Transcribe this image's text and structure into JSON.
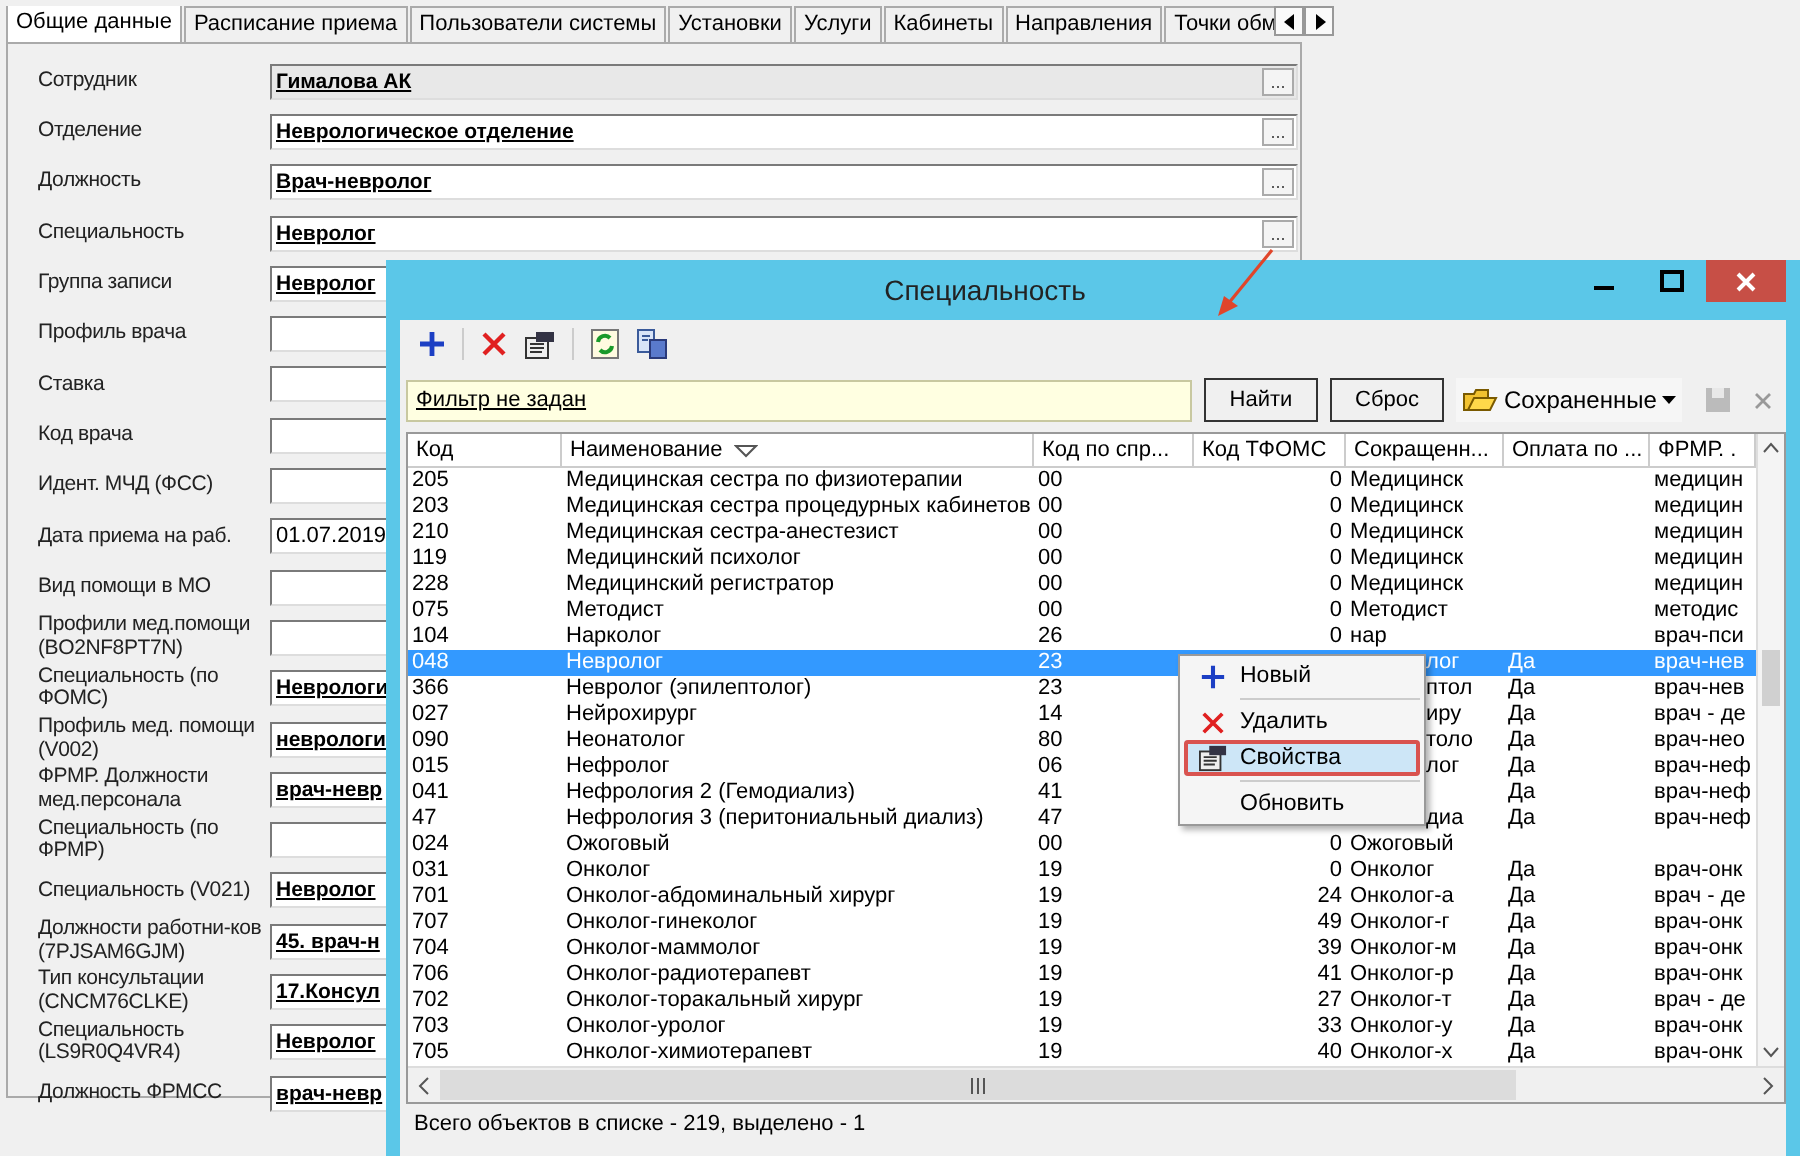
{
  "tabs": [
    {
      "label": "Общие данные",
      "selected": true
    },
    {
      "label": "Расписание приема",
      "selected": false
    },
    {
      "label": "Пользователи системы",
      "selected": false
    },
    {
      "label": "Установки",
      "selected": false
    },
    {
      "label": "Услуги",
      "selected": false
    },
    {
      "label": "Кабинеты",
      "selected": false
    },
    {
      "label": "Направления",
      "selected": false
    },
    {
      "label": "Точки обм",
      "selected": false
    }
  ],
  "fields": [
    {
      "label": "Сотрудник",
      "value": "Гималова АК",
      "kind": "picker",
      "button": "...",
      "disabled": true
    },
    {
      "label": "Отделение",
      "value": "Неврологическое отделение",
      "kind": "picker",
      "button": "...",
      "disabled": false
    },
    {
      "label": "Должность",
      "value": "Врач-невролог",
      "kind": "picker",
      "button": "...",
      "disabled": false
    },
    {
      "label": "Специальность",
      "value": "Невролог",
      "kind": "picker",
      "button": "...",
      "disabled": false
    },
    {
      "label": "Группа записи",
      "value": "Невролог",
      "kind": "ref",
      "disabled": false
    },
    {
      "label": "Профиль врача",
      "kind": "input",
      "disabled": false
    },
    {
      "label": "Ставка",
      "kind": "input",
      "disabled": false
    },
    {
      "label": "Код врача",
      "kind": "input",
      "disabled": false
    },
    {
      "label": "Идент. МЧД (ФСС)",
      "kind": "input",
      "disabled": false
    },
    {
      "label": "Дата приема на раб.",
      "value": "01.07.2019",
      "kind": "input",
      "disabled": false
    },
    {
      "label": "Вид помощи в МО",
      "kind": "input",
      "disabled": false
    },
    {
      "label": "Профили мед.помощи (BO2NF8PT7N)",
      "kind": "input",
      "disabled": false
    },
    {
      "label": "Специальность (по ФОМС)",
      "value": "Неврологи",
      "kind": "ref",
      "disabled": false
    },
    {
      "label": "Профиль мед. помощи (V002)",
      "value": "неврологи",
      "kind": "ref",
      "disabled": false
    },
    {
      "label": "ФРМР. Должности мед.персонала",
      "value": "врач-невр",
      "kind": "ref",
      "disabled": false
    },
    {
      "label": "Специальность (по ФРМР)",
      "kind": "input",
      "disabled": false
    },
    {
      "label": "Специальность (V021)",
      "value": "Невролог",
      "kind": "ref",
      "disabled": false
    },
    {
      "label": "Должности работни-ков (7PJSAM6GJM)",
      "value": "45. врач-н",
      "kind": "ref",
      "disabled": false
    },
    {
      "label": "Тип консультации (CNCM76CLKE)",
      "value": "17.Консул",
      "kind": "ref",
      "disabled": false
    },
    {
      "label": "Специальность (LS9R0Q4VR4)",
      "value": "Невролог",
      "kind": "ref",
      "disabled": false
    },
    {
      "label": "Должность ФРМСС",
      "value": "врач-невр",
      "kind": "ref",
      "disabled": false
    }
  ],
  "dialog": {
    "title": "Специальность",
    "filter": {
      "text": "Фильтр не задан",
      "find_button": "Найти",
      "reset_button": "Сброс",
      "saved_button": "Сохраненные"
    },
    "columns": [
      "Код",
      "Наименование",
      "Код по спр...",
      "Код ТФОМС",
      "Сокращенн...",
      "Оплата по ...",
      "ФРМР. ."
    ],
    "rows": [
      {
        "code": "205",
        "name": "Медицинская сестра по физиотерапии",
        "code_sp": "00",
        "tfoms": "0",
        "short": "Медицинск",
        "frmp": "медицин",
        "selected": false
      },
      {
        "code": "203",
        "name": "Медицинская сестра процедурных кабинетов",
        "code_sp": "00",
        "tfoms": "0",
        "short": "Медицинск",
        "frmp": "медицин",
        "selected": false
      },
      {
        "code": "210",
        "name": "Медицинская сестра-анестезист",
        "code_sp": "00",
        "tfoms": "0",
        "short": "Медицинск",
        "frmp": "медицин",
        "selected": false
      },
      {
        "code": "119",
        "name": "Медицинский психолог",
        "code_sp": "00",
        "tfoms": "0",
        "short": "Медицинск",
        "frmp": "медицин",
        "selected": false
      },
      {
        "code": "228",
        "name": "Медицинский регистратор",
        "code_sp": "00",
        "tfoms": "0",
        "short": "Медицинск",
        "frmp": "медицин",
        "selected": false
      },
      {
        "code": "075",
        "name": "Методист",
        "code_sp": "00",
        "tfoms": "0",
        "short": "Методист",
        "frmp": "методис",
        "selected": false
      },
      {
        "code": "104",
        "name": "Нарколог",
        "code_sp": "26",
        "tfoms": "0",
        "short": "нар",
        "frmp": "врач-пси",
        "selected": false
      },
      {
        "code": "048",
        "name": "Невролог",
        "code_sp": "23",
        "short_tail": "лог",
        "payment": "Да",
        "frmp": "врач-нев",
        "selected": true
      },
      {
        "code": "366",
        "name": "Невролог (эпилептолог)",
        "code_sp": "23",
        "short_tail": "птол",
        "payment": "Да",
        "frmp": "врач-нев",
        "selected": false
      },
      {
        "code": "027",
        "name": "Нейрохирург",
        "code_sp": "14",
        "short_tail": "иру",
        "payment": "Да",
        "frmp": "врач - де",
        "selected": false
      },
      {
        "code": "090",
        "name": "Неонатолог",
        "code_sp": "80",
        "short_tail": "толо",
        "payment": "Да",
        "frmp": "врач-нео",
        "selected": false
      },
      {
        "code": "015",
        "name": "Нефролог",
        "code_sp": "06",
        "short_tail": "лог",
        "payment": "Да",
        "frmp": "врач-неф",
        "selected": false
      },
      {
        "code": "041",
        "name": "Нефрология 2 (Гемодиализ)",
        "code_sp": "41",
        "payment": "Да",
        "frmp": "врач-неф",
        "selected": false
      },
      {
        "code": "47",
        "name": "Нефрология 3 (перитониальный диализ)",
        "code_sp": "47",
        "short_tail": "диа",
        "payment": "Да",
        "frmp": "врач-неф",
        "selected": false
      },
      {
        "code": "024",
        "name": "Ожоговый",
        "code_sp": "00",
        "tfoms": "0",
        "short": "Ожоговый",
        "selected": false
      },
      {
        "code": "031",
        "name": "Онколог",
        "code_sp": "19",
        "tfoms": "0",
        "short": "Онколог",
        "payment": "Да",
        "frmp": "врач-онк",
        "selected": false
      },
      {
        "code": "701",
        "name": "Онколог-абдоминальный хирург",
        "code_sp": "19",
        "tfoms": "24",
        "short": "Онколог-а",
        "payment": "Да",
        "frmp": "врач - де",
        "selected": false
      },
      {
        "code": "707",
        "name": "Онколог-гинеколог",
        "code_sp": "19",
        "tfoms": "49",
        "short": "Онколог-г",
        "payment": "Да",
        "frmp": "врач-онк",
        "selected": false
      },
      {
        "code": "704",
        "name": "Онколог-маммолог",
        "code_sp": "19",
        "tfoms": "39",
        "short": "Онколог-м",
        "payment": "Да",
        "frmp": "врач-онк",
        "selected": false
      },
      {
        "code": "706",
        "name": "Онколог-радиотерапевт",
        "code_sp": "19",
        "tfoms": "41",
        "short": "Онколог-р",
        "payment": "Да",
        "frmp": "врач-онк",
        "selected": false
      },
      {
        "code": "702",
        "name": "Онколог-торакальный хирург",
        "code_sp": "19",
        "tfoms": "27",
        "short": "Онколог-т",
        "payment": "Да",
        "frmp": "врач - де",
        "selected": false
      },
      {
        "code": "703",
        "name": "Онколог-уролог",
        "code_sp": "19",
        "tfoms": "33",
        "short": "Онколог-у",
        "payment": "Да",
        "frmp": "врач-онк",
        "selected": false
      },
      {
        "code": "705",
        "name": "Онколог-химиотерапевт",
        "code_sp": "19",
        "tfoms": "40",
        "short": "Онколог-х",
        "payment": "Да",
        "frmp": "врач-онк",
        "selected": false
      }
    ],
    "context_menu": [
      {
        "label": "Новый",
        "kind": "new",
        "selected": false
      },
      {
        "label": "Удалить",
        "kind": "delete",
        "selected": false
      },
      {
        "label": "Свойства",
        "kind": "properties",
        "selected": true
      },
      {
        "label": "Обновить",
        "kind": "refresh",
        "selected": false
      }
    ],
    "status": "Всего объектов в списке - 219, выделено - 1"
  }
}
